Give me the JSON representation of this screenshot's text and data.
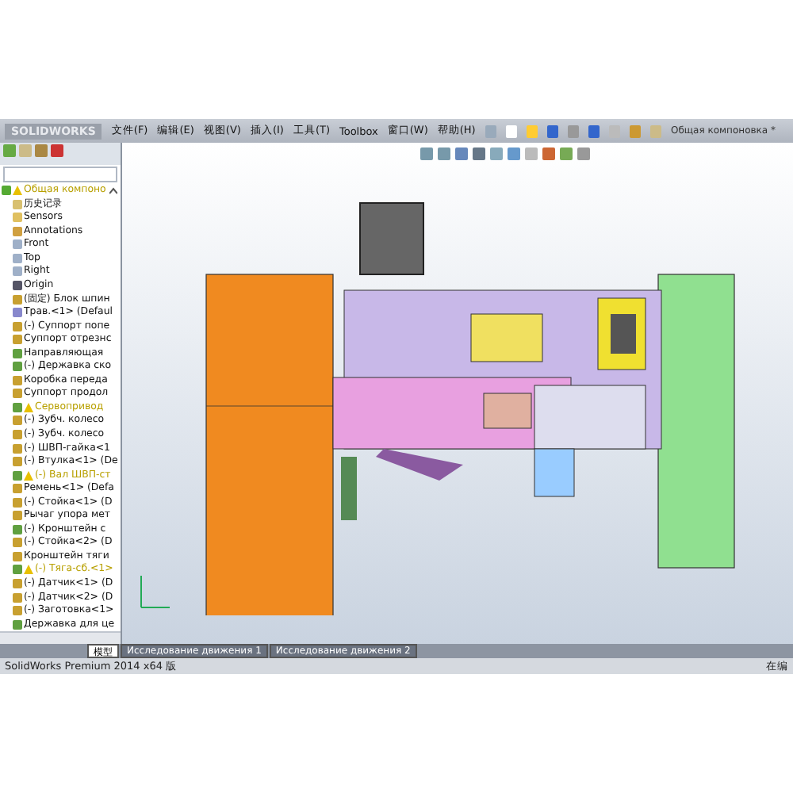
{
  "app": {
    "logo": "SOLIDWORKS"
  },
  "menu": [
    "文件(F)",
    "编辑(E)",
    "视图(V)",
    "插入(I)",
    "工具(T)",
    "Toolbox",
    "窗口(W)",
    "帮助(H)"
  ],
  "document_title": "Общая компоновка *",
  "tree": {
    "root": {
      "label": "Общая компоно",
      "warning": true,
      "expanded": true
    },
    "items": [
      {
        "label": "历史记录",
        "kind": "history",
        "warning": false
      },
      {
        "label": "Sensors",
        "kind": "sensor",
        "warning": false
      },
      {
        "label": "Annotations",
        "kind": "annotation",
        "warning": false
      },
      {
        "label": "Front",
        "kind": "plane",
        "warning": false
      },
      {
        "label": "Top",
        "kind": "plane",
        "warning": false
      },
      {
        "label": "Right",
        "kind": "plane",
        "warning": false
      },
      {
        "label": "Origin",
        "kind": "origin",
        "warning": false
      },
      {
        "label": "(固定) Блок шпин",
        "kind": "assembly",
        "warning": false
      },
      {
        "label": "Трав.<1> (Defaul",
        "kind": "part",
        "warning": false
      },
      {
        "label": "(-) Суппорт попе",
        "kind": "assembly",
        "warning": false
      },
      {
        "label": "Суппорт отрезнс",
        "kind": "assembly",
        "warning": false
      },
      {
        "label": "Направляющая",
        "kind": "subassembly",
        "warning": false
      },
      {
        "label": "(-) Державка ско",
        "kind": "subassembly",
        "warning": false
      },
      {
        "label": "Коробка переда",
        "kind": "assembly",
        "warning": false
      },
      {
        "label": "Суппорт продол",
        "kind": "assembly",
        "warning": false
      },
      {
        "label": "Сервопривод",
        "kind": "subassembly",
        "warning": true
      },
      {
        "label": "(-) Зубч. колесо",
        "kind": "assembly",
        "warning": false
      },
      {
        "label": "(-) Зубч. колесо",
        "kind": "assembly",
        "warning": false
      },
      {
        "label": "(-) ШВП-гайка<1",
        "kind": "assembly",
        "warning": false
      },
      {
        "label": "(-) Втулка<1> (De",
        "kind": "assembly",
        "warning": false
      },
      {
        "label": "(-) Вал ШВП-ст",
        "kind": "subassembly",
        "warning": true
      },
      {
        "label": "Ремень<1> (Defa",
        "kind": "assembly",
        "warning": false
      },
      {
        "label": "(-) Стойка<1> (D",
        "kind": "assembly",
        "warning": false
      },
      {
        "label": "Рычаг упора мет",
        "kind": "assembly",
        "warning": false
      },
      {
        "label": "(-) Кронштейн с",
        "kind": "subassembly",
        "warning": false
      },
      {
        "label": "(-) Стойка<2> (D",
        "kind": "assembly",
        "warning": false
      },
      {
        "label": "Кронштейн тяги",
        "kind": "assembly",
        "warning": false
      },
      {
        "label": "(-) Тяга-сб.<1>",
        "kind": "subassembly",
        "warning": true
      },
      {
        "label": "(-) Датчик<1> (D",
        "kind": "assembly",
        "warning": false
      },
      {
        "label": "(-) Датчик<2> (D",
        "kind": "assembly",
        "warning": false
      },
      {
        "label": "(-) Заготовка<1>",
        "kind": "assembly",
        "warning": false
      },
      {
        "label": "Державка для це",
        "kind": "subassembly",
        "warning": false
      }
    ]
  },
  "tabs": [
    {
      "label": "模型",
      "selected": true
    },
    {
      "label": "Исследование движения 1",
      "selected": false
    },
    {
      "label": "Исследование движения 2",
      "selected": false
    }
  ],
  "status_bar": {
    "left": "SolidWorks Premium 2014 x64 版",
    "right": "在编"
  }
}
